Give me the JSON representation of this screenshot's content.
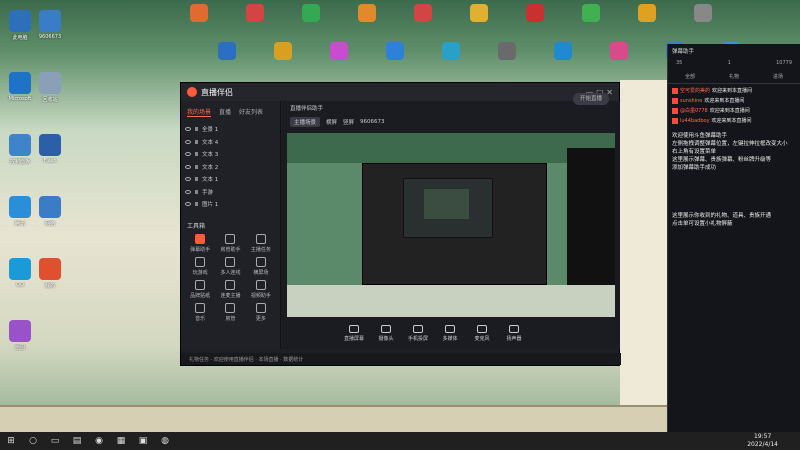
{
  "desktop": {
    "left_icons": [
      {
        "label": "此电脑",
        "color": "#2d6fb8"
      },
      {
        "label": "9606673",
        "color": "#3b7cc7"
      },
      {
        "label": "Microsoft",
        "color": "#1e72c8"
      },
      {
        "label": "回收站",
        "color": "#8aa0b8"
      },
      {
        "label": "控制面板",
        "color": "#3e84c9"
      },
      {
        "label": "Flash",
        "color": "#2b5fa8"
      },
      {
        "label": "腾讯",
        "color": "#2a8fd8"
      },
      {
        "label": "网络",
        "color": "#3b7cc7"
      },
      {
        "label": "QQ",
        "color": "#1a9ad6"
      },
      {
        "label": "我的",
        "color": "#e0502f"
      },
      {
        "label": "画图",
        "color": "#9a52c9"
      }
    ],
    "top_icons_colors": [
      "#e06a2f",
      "#2a6fc2",
      "#d34545",
      "#d9a020",
      "#34a853",
      "#c94bd0",
      "#e08a2a",
      "#2d82d8",
      "#d24545",
      "#28a0c8",
      "#e0b030",
      "#6a6a6a",
      "#c93030",
      "#1f8ad0",
      "#40b050",
      "#d84a8a",
      "#e0a020",
      "#3d7bd0",
      "#888888",
      "#2a9ad6"
    ]
  },
  "app": {
    "title": "直播伴侣",
    "tabs": [
      "我的场景",
      "直播",
      "好友列表"
    ],
    "scene_title": "直播伴侣助手",
    "scene_buttons": [
      "主播场景",
      "横屏",
      "竖屏",
      "9606673"
    ],
    "layers": [
      "全景 1",
      "文本 4",
      "文本 3",
      "文本 2",
      "文本 1",
      "手游",
      "图片 1"
    ],
    "tools_title": "工具箱",
    "tools": [
      "弹幕助手",
      "房管助手",
      "主播任务",
      "玩游戏",
      "多人连线",
      "横屏场",
      "品牌贴纸",
      "连麦主播",
      "视频助手",
      "音乐",
      "房管",
      "更多"
    ],
    "controls": [
      "直播屏幕",
      "摄像头",
      "手机投屏",
      "多媒体",
      "麦克风",
      "扬声器"
    ],
    "go_live": "开始直播",
    "status": "礼物任务 · 欢迎使用直播伴侣 · 本场直播 · 数据统计"
  },
  "chat": {
    "header": "弹幕助手",
    "stats": [
      "35",
      "1",
      "10779"
    ],
    "tabs": [
      "全部",
      "礼物",
      "进场"
    ],
    "messages": [
      {
        "name": "空可爱的美的",
        "text": "欢迎来到本直播间"
      },
      {
        "name": "sunshine",
        "text": "欢迎来到本直播间"
      },
      {
        "name": "@白墨0778",
        "text": "欢迎来到本直播间"
      },
      {
        "name": "lu44badboy",
        "text": "欢迎来到本直播间"
      }
    ],
    "note1": "欢迎使用斗鱼弹幕助手\n左侧拖拽调整弹幕位置，左键拉伸拉框改变大小\n右上角有设置菜单\n这里展示弹幕、贵族弹幕、粉丝牌升级等\n添加弹幕助手成功",
    "note2": "这里展示你收到的礼物、道具、贵族开通\n点击单可设置小礼物屏蔽"
  },
  "taskbar": {
    "time": "19:57",
    "date": "2022/4/14"
  }
}
